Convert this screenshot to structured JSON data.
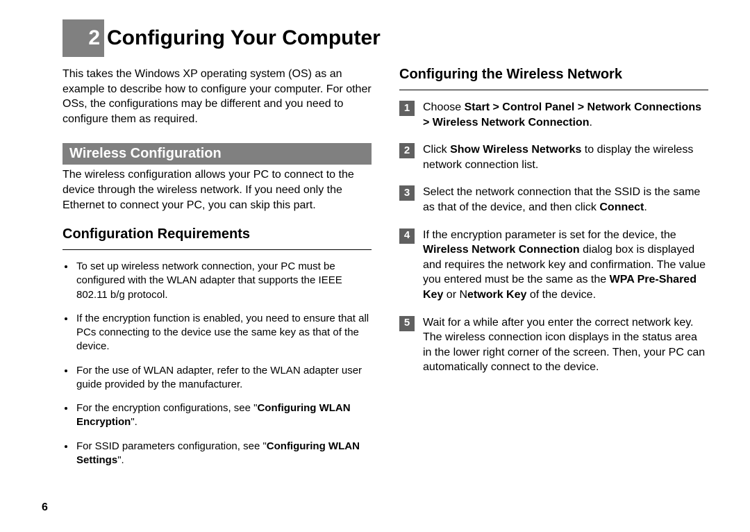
{
  "chapter": {
    "number": "2",
    "title": "Configuring Your Computer"
  },
  "intro": "This takes the Windows XP operating system (OS) as an example to describe how to configure your computer. For other OSs, the configurations may be different and you need to configure them as required.",
  "wireless_config": {
    "heading": "Wireless Configuration",
    "desc": "The wireless configuration allows your PC to connect to the device through the wireless network. If you need only the Ethernet to connect your PC, you can skip this part."
  },
  "config_req": {
    "heading": "Configuration Requirements",
    "items": {
      "0": "To set up wireless network connection, your PC must be configured with the WLAN adapter that supports the IEEE 802.11 b/g protocol.",
      "1": "If the encryption function is enabled, you need to ensure that all PCs connecting to the device use the same key as that of the device.",
      "2": "For the use of WLAN adapter, refer to the WLAN adapter user guide provided by the manufacturer.",
      "3_pre": "For the encryption configurations, see \"",
      "3_b": "Configuring WLAN Encryption",
      "3_post": "\".",
      "4_pre": "For SSID parameters configuration, see \"",
      "4_b": "Configuring WLAN Settings",
      "4_post": "\"."
    }
  },
  "config_net": {
    "heading": "Configuring the Wireless Network",
    "steps": {
      "1": {
        "num": "1",
        "pre": "Choose ",
        "b": "Start > Control Panel > Network Connections > Wireless Network Connection",
        "post": "."
      },
      "2": {
        "num": "2",
        "pre": "Click ",
        "b": "Show Wireless Networks",
        "post": " to display the wireless network connection list."
      },
      "3": {
        "num": "3",
        "pre": "Select the network connection that the SSID is the same as that of the device, and then click ",
        "b": "Connect",
        "post": "."
      },
      "4": {
        "num": "4",
        "pre": "If the encryption parameter is set for the device, the ",
        "b1": "Wireless Network Connection",
        "mid1": " dialog box is displayed and requires the network key and confirmation. The value you entered must be the same as the ",
        "b2": "WPA Pre-Shared Key",
        "mid2": " or N",
        "b3": "etwork Key",
        "post": " of the device."
      },
      "5": {
        "num": "5",
        "text": "Wait for a while after you enter the correct network key. The wireless connection icon displays in the status area in the lower right corner of the screen. Then, your PC can automatically connect to the device."
      }
    }
  },
  "page_number": "6"
}
